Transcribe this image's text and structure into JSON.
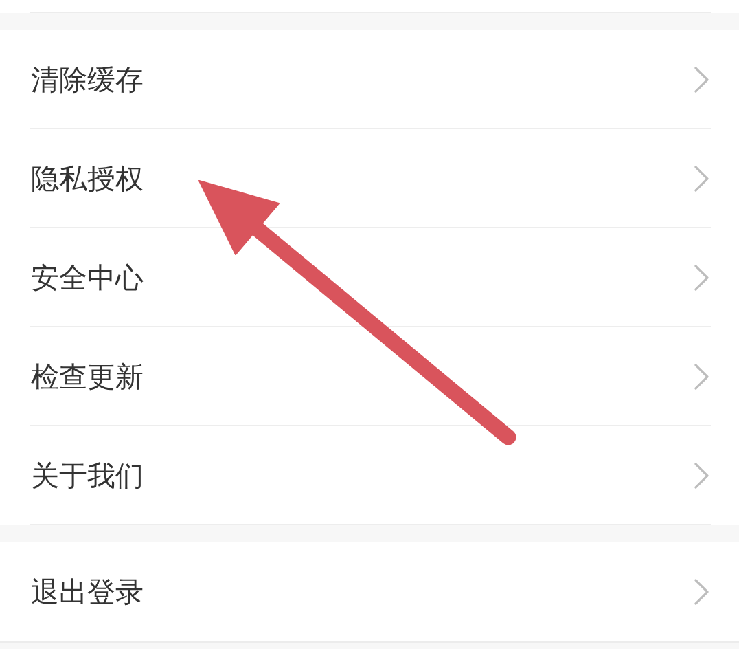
{
  "sections": [
    {
      "items": [
        {
          "label": "清除缓存"
        },
        {
          "label": "隐私授权"
        },
        {
          "label": "安全中心"
        },
        {
          "label": "检查更新"
        },
        {
          "label": "关于我们"
        }
      ]
    },
    {
      "items": [
        {
          "label": "退出登录"
        }
      ]
    }
  ],
  "annotation": {
    "kind": "arrow"
  }
}
